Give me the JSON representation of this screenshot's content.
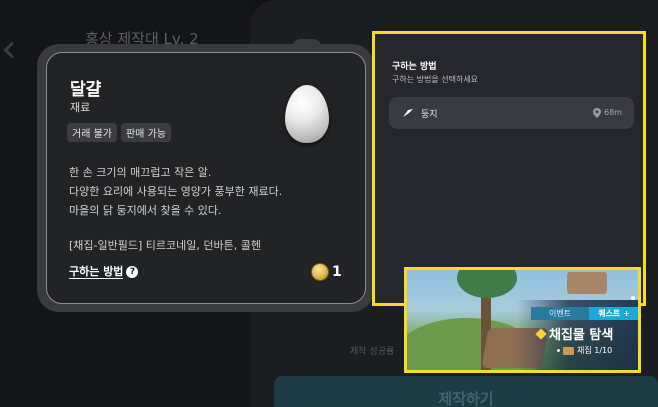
{
  "background": {
    "title": "홍상 제작대 Lv. 2",
    "success_text": "제작 성공률",
    "craft_button": "제작하기"
  },
  "item": {
    "name": "달걀",
    "type": "재료",
    "tags": [
      "거래 불가",
      "판매 가능"
    ],
    "description": [
      "한 손 크기의 매끄럽고 작은 알.",
      "다양한 요리에 사용되는 영양가 풍부한 재료다.",
      "마을의 닭 둥지에서 찾을 수 있다."
    ],
    "sources": "[채집-일반필드] 티르코네일, 던바튼, 콜헨",
    "how_to_get_link": "구하는 방법",
    "help_icon": "?",
    "coin_icon": "gold-coin-icon",
    "count": "1"
  },
  "acquisition": {
    "title": "구하는 방법",
    "subtitle": "구하는 방법을 선택하세요",
    "options": [
      {
        "icon": "navigate-arrow-icon",
        "label": "둥지",
        "distance": "68m"
      }
    ]
  },
  "quest_banner": {
    "event_label": "이벤트",
    "quest_button": "퀘스트 +",
    "title": "채집물 탐색",
    "progress": "채집 1/10"
  },
  "colors": {
    "highlight": "#f4dc2a",
    "card_bg": "#222325",
    "panel_bg": "#26272c",
    "quest_button": "#1fa7d9"
  }
}
